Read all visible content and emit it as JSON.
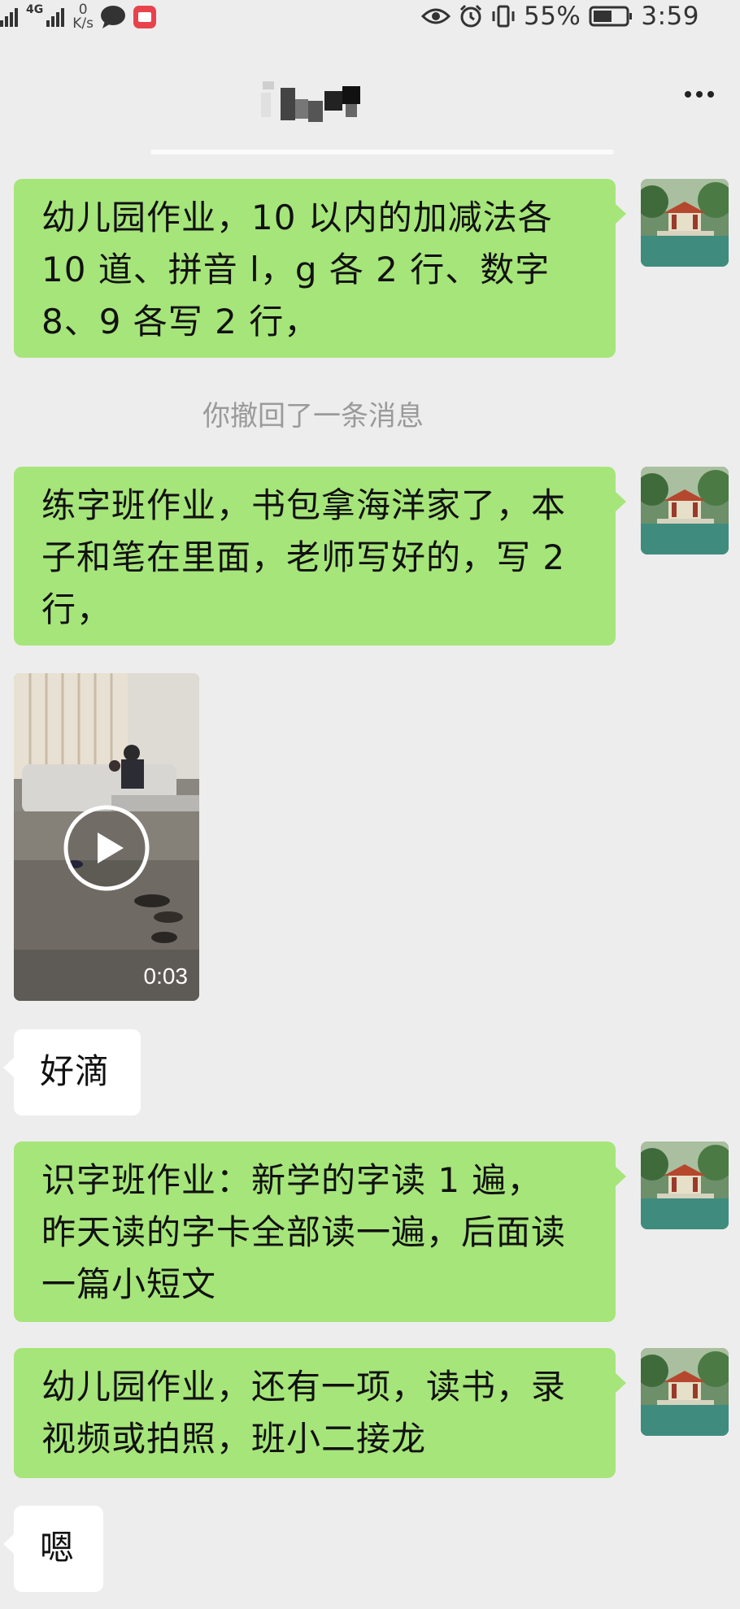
{
  "status_bar": {
    "signal": "4G",
    "net_speed_value": "0",
    "net_speed_unit": "K/s",
    "battery": "55%",
    "time": "3:59"
  },
  "header": {
    "title": "",
    "more_icon": "more-dots-icon"
  },
  "messages": {
    "m1": {
      "side": "right",
      "text": "幼儿园作业，10 以内的加减法各10 道、拼音 l，g 各 2 行、数字8、9 各写 2 行，"
    },
    "m1_lines": [
      "幼儿园作业，10 以内的加减法各",
      "10 道、拼音 l，g 各 2 行、数字",
      "8、9 各写 2 行，"
    ],
    "notice": "你撤回了一条消息",
    "m2_lines": [
      "练字班作业，书包拿海洋家了，本",
      "子和笔在里面，老师写好的，写 2",
      "行，"
    ],
    "video": {
      "duration": "0:03"
    },
    "m3": "好滴",
    "m4_lines": [
      "识字班作业：新学的字读 1 遍，",
      "昨天读的字卡全部读一遍，后面读",
      "一篇小短文"
    ],
    "m5_lines": [
      "幼儿园作业，还有一项，读书，录",
      "视频或拍照，班小二接龙"
    ],
    "m6": "嗯"
  },
  "colors": {
    "background": "#ededed",
    "self_bubble": "#a6e57a",
    "other_bubble": "#ffffff",
    "notice_text": "#9a9a9a"
  }
}
